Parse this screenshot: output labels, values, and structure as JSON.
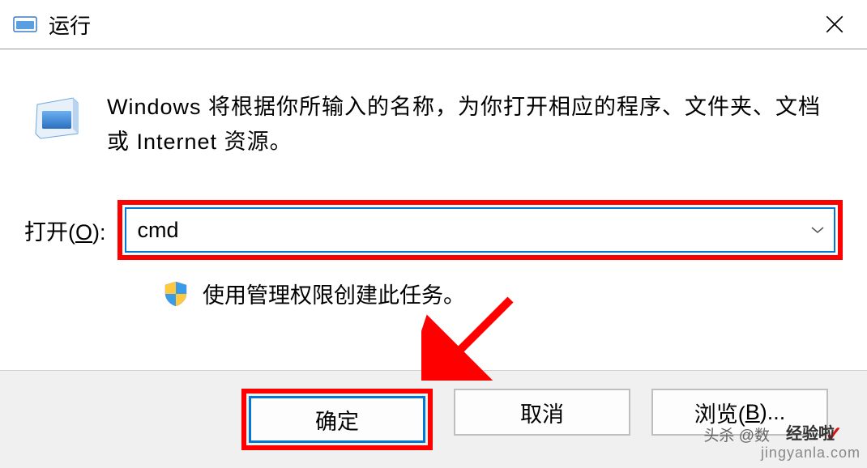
{
  "titlebar": {
    "title": "运行"
  },
  "content": {
    "description": "Windows 将根据你所输入的名称，为你打开相应的程序、文件夹、文档或 Internet 资源。",
    "open_label_prefix": "打开(",
    "open_label_key": "O",
    "open_label_suffix": "):",
    "input_value": "cmd",
    "admin_text": "使用管理权限创建此任务。"
  },
  "buttons": {
    "ok": "确定",
    "cancel": "取消",
    "browse_prefix": "浏览(",
    "browse_key": "B",
    "browse_suffix": ")..."
  },
  "watermark": {
    "header": "头杀 @数",
    "logo_text": "经验啦",
    "site": "jingyanla.com"
  }
}
